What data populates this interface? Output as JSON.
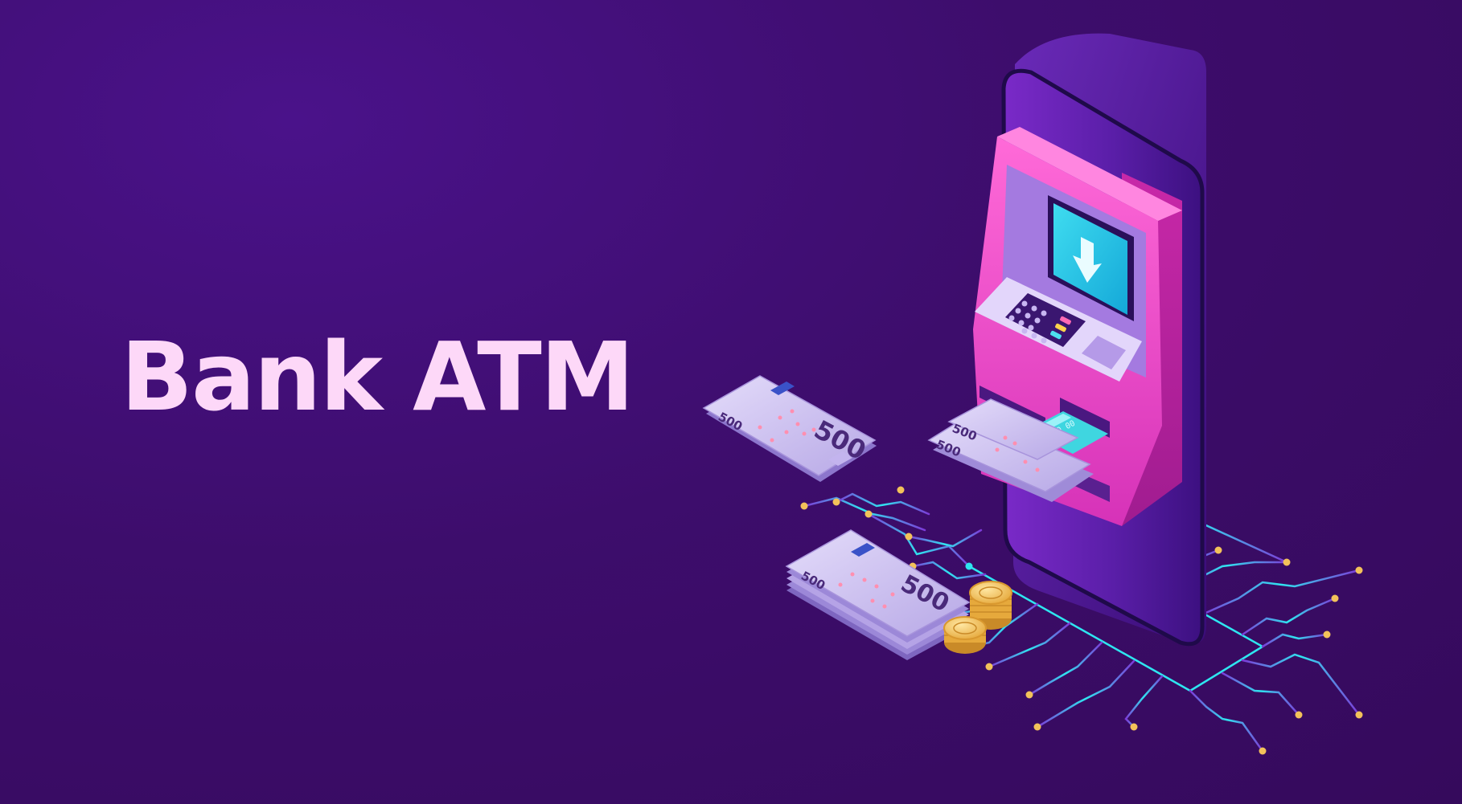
{
  "title": "Bank ATM",
  "banknotes": {
    "loose_note_label_small": "500",
    "loose_note_label_large": "500",
    "dispensed_note_label_1": "500",
    "dispensed_note_label_2": "500",
    "stack_note_label_small": "500",
    "stack_note_label_large": "500"
  },
  "card": {
    "number": "0000 00"
  },
  "colors": {
    "background": "#3d0e66",
    "title": "#fdd8f8",
    "atm_body": "#e040c8",
    "screen": "#22d4e6",
    "circuit": "#2ee6f0",
    "coins": "#f3c25a",
    "banknote": "#cfc3f0"
  },
  "icons": {
    "screen_icon": "download-arrow-icon"
  }
}
